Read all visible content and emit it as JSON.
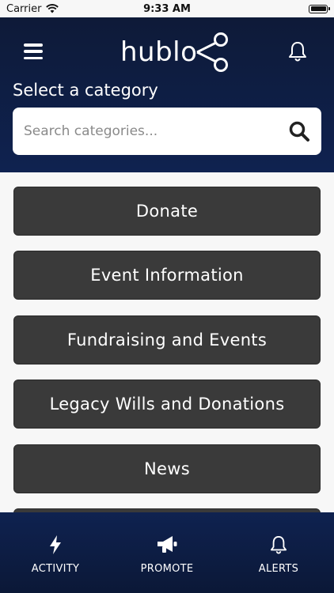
{
  "status_bar": {
    "carrier": "Carrier",
    "time": "9:33 AM"
  },
  "header": {
    "logo": "hublo",
    "section_title": "Select a category",
    "search": {
      "placeholder": "Search categories...",
      "value": ""
    }
  },
  "categories": [
    "Donate",
    "Event Information",
    "Fundraising and Events",
    "Legacy Wills and Donations",
    "News",
    ""
  ],
  "tabs": [
    {
      "label": "ACTIVITY",
      "icon": "lightning-icon"
    },
    {
      "label": "PROMOTE",
      "icon": "megaphone-icon"
    },
    {
      "label": "ALERTS",
      "icon": "bell-icon"
    }
  ],
  "colors": {
    "header_bg": "#0e1a38",
    "button_bg": "#3a3a3a",
    "tabbar_bg": "#0f2250"
  }
}
